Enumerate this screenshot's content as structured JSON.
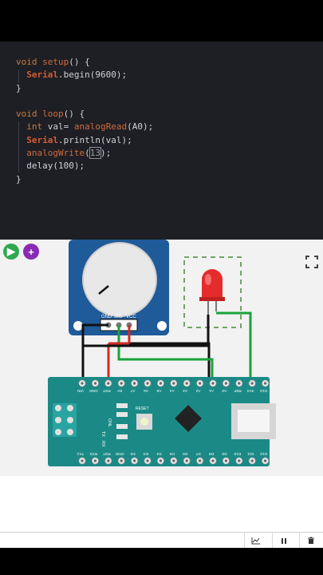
{
  "editor": {
    "lines": [
      {
        "kw": "void",
        "fn": "setup",
        "rest": "() {"
      },
      {
        "cls": "Serial",
        "rest": ".begin(9600);"
      },
      {
        "rest": "}"
      },
      {
        "kw": "void",
        "fn": "loop",
        "rest": "() {"
      },
      {
        "kw2": "int",
        "rest": "val= ",
        "fn": "analogRead",
        "rest2": "(A0);"
      },
      {
        "cls": "Serial",
        "rest": ".println(val);"
      },
      {
        "fn": "analogWrite",
        "rest": "(",
        "num": "13",
        "rest2": ");"
      },
      {
        "rest": "delay(100);"
      },
      {
        "rest": "}"
      }
    ]
  },
  "sim": {
    "play_icon": "play-icon",
    "add_icon": "plus-icon",
    "fullscreen_icon": "fullscreen-icon",
    "pot_pins": [
      "GND",
      "SIG",
      "VCC"
    ],
    "nano_top_pins": [
      "VIN",
      "GND",
      "RST",
      "5V",
      "A7",
      "A6",
      "A5",
      "A4",
      "A3",
      "A2",
      "A1",
      "A0",
      "REF",
      "3V3",
      "D13"
    ],
    "nano_bottom_pins": [
      "TX1",
      "RX0",
      "RST",
      "GND",
      "D2",
      "D3",
      "D4",
      "D5",
      "D6",
      "D7",
      "D8",
      "D9",
      "D10",
      "D11",
      "D12"
    ],
    "nano_side_labels": [
      "ON",
      "L",
      "TX",
      "RX"
    ],
    "nano_reset_label": "RESET",
    "colors": {
      "board": "#1b8a86",
      "wire_green": "#1aa33a",
      "wire_red": "#d12b22",
      "wire_black": "#111111",
      "led": "#e52c2c",
      "pot": "#1f5a99"
    }
  },
  "toolbar": {
    "chart_icon": "chart-icon",
    "pause_icon": "pause-icon",
    "trash_icon": "trash-icon"
  }
}
